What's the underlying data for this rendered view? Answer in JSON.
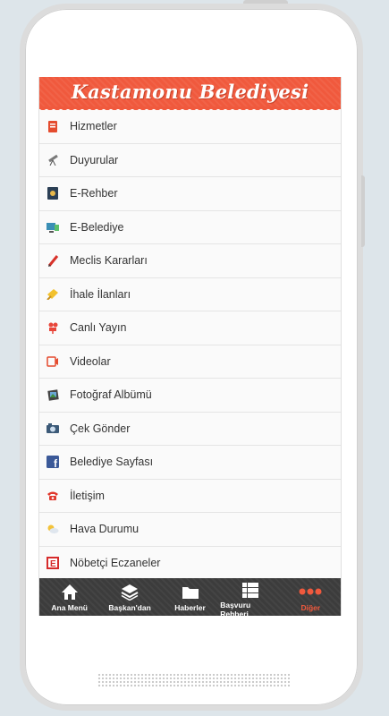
{
  "header": {
    "title": "Kastamonu Belediyesi"
  },
  "menu": {
    "items": [
      {
        "label": "Hizmetler",
        "icon": "book-icon"
      },
      {
        "label": "Duyurular",
        "icon": "telescope-icon"
      },
      {
        "label": "E-Rehber",
        "icon": "phonebook-icon"
      },
      {
        "label": "E-Belediye",
        "icon": "computer-icon"
      },
      {
        "label": "Meclis Kararları",
        "icon": "pencil-icon"
      },
      {
        "label": "İhale İlanları",
        "icon": "gavel-icon"
      },
      {
        "label": "Canlı Yayın",
        "icon": "camera-icon"
      },
      {
        "label": "Videolar",
        "icon": "video-icon"
      },
      {
        "label": "Fotoğraf Albümü",
        "icon": "photo-album-icon"
      },
      {
        "label": "Çek Gönder",
        "icon": "photo-camera-icon"
      },
      {
        "label": "Belediye Sayfası",
        "icon": "facebook-icon"
      },
      {
        "label": "İletişim",
        "icon": "telephone-icon"
      },
      {
        "label": "Hava Durumu",
        "icon": "weather-icon"
      },
      {
        "label": "Nöbetçi Eczaneler",
        "icon": "pharmacy-icon"
      }
    ]
  },
  "tabbar": {
    "tabs": [
      {
        "label": "Ana Menü",
        "icon": "home-icon"
      },
      {
        "label": "Başkan'dan",
        "icon": "layers-icon"
      },
      {
        "label": "Haberler",
        "icon": "folder-icon"
      },
      {
        "label": "Başvuru Rehberi",
        "icon": "list-icon"
      },
      {
        "label": "Diğer",
        "icon": "more-icon"
      }
    ],
    "active_tab": "Diğer"
  },
  "colors": {
    "accent": "#f0593d",
    "tabbar": "#3c3c3c"
  }
}
